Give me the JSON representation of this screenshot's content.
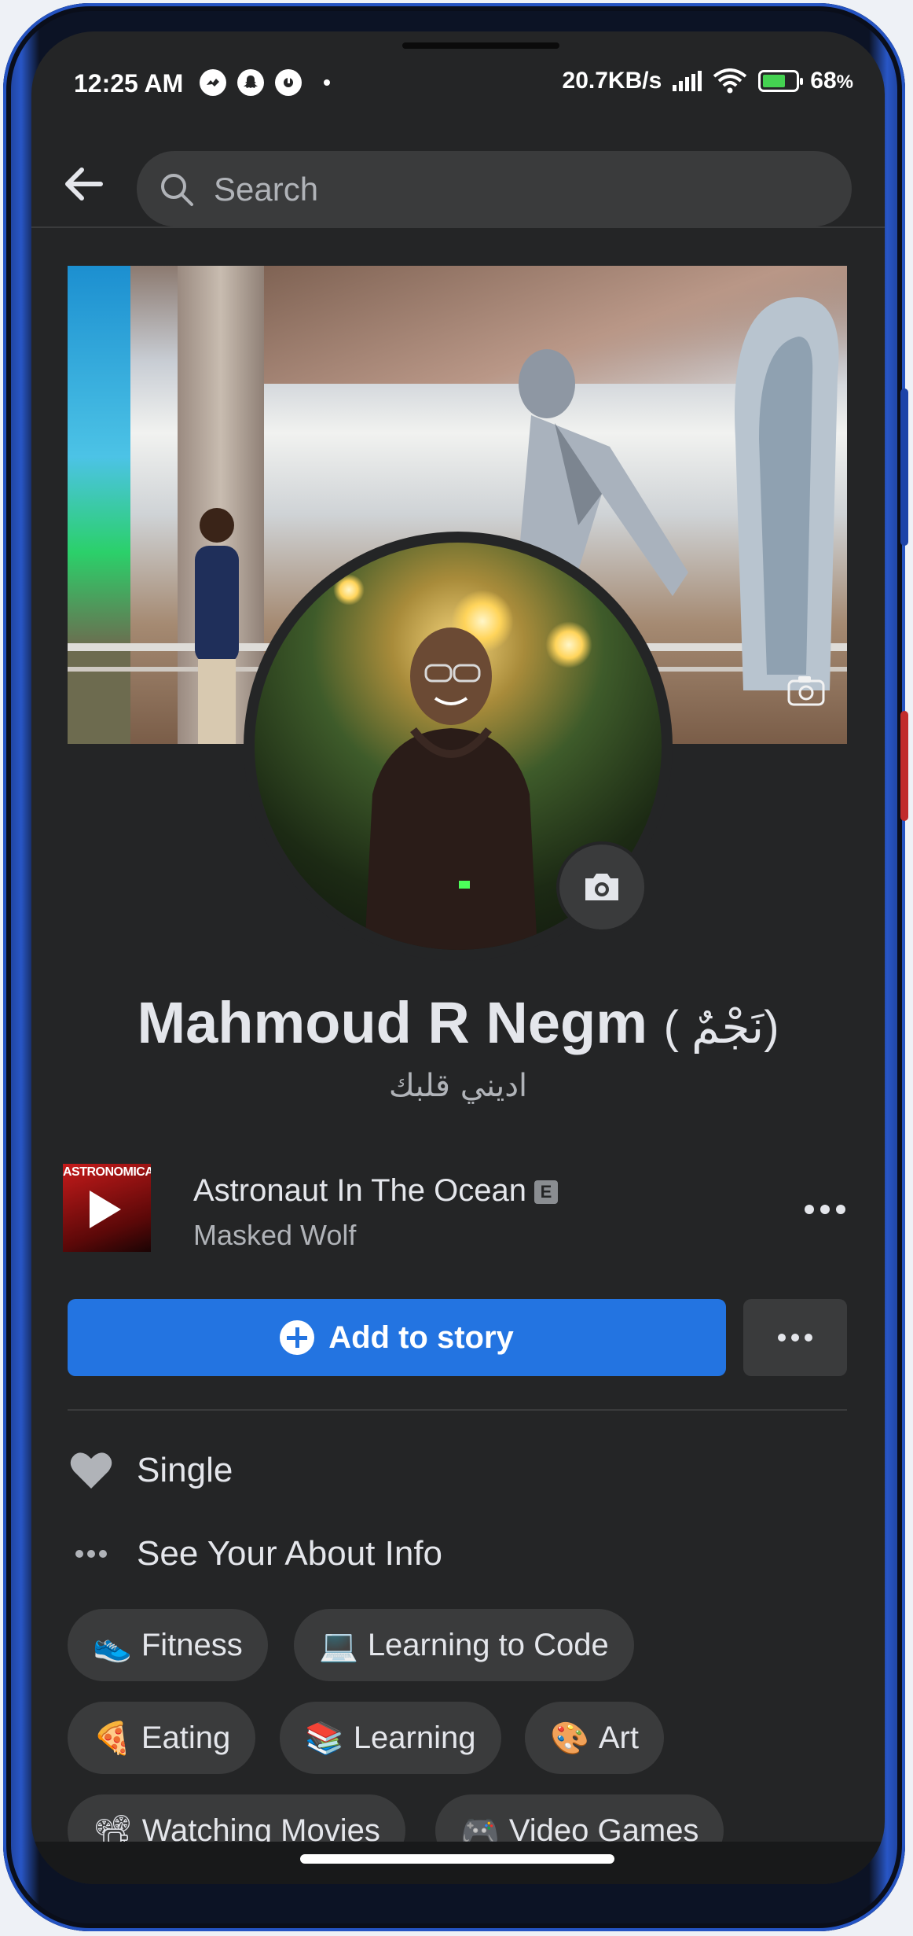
{
  "status_bar": {
    "time": "12:25 AM",
    "network_speed": "20.7KB/s",
    "battery": "68",
    "battery_unit": "%"
  },
  "search": {
    "placeholder": "Search"
  },
  "profile": {
    "name": "Mahmoud R Negm",
    "alt_name": "( نَجْمٌ)",
    "bio": "اديني قلبك"
  },
  "song": {
    "album_text": "ASTRONOMICAL",
    "title": "Astronaut In The Ocean",
    "explicit_badge": "E",
    "artist": "Masked Wolf"
  },
  "actions": {
    "add_story": "Add to story"
  },
  "about": {
    "relationship": "Single",
    "see_about": "See Your About Info"
  },
  "hobbies": [
    {
      "emoji": "👟",
      "label": "Fitness"
    },
    {
      "emoji": "💻",
      "label": "Learning to Code"
    },
    {
      "emoji": "🍕",
      "label": "Eating"
    },
    {
      "emoji": "📚",
      "label": "Learning"
    },
    {
      "emoji": "🎨",
      "label": "Art"
    },
    {
      "emoji": "📽",
      "label": "Watching Movies"
    },
    {
      "emoji": "🎮",
      "label": "Video Games"
    }
  ],
  "icons": {
    "back": "arrow-left-icon",
    "search": "search-icon",
    "camera": "camera-icon",
    "heart": "heart-icon",
    "more": "more-dots-icon",
    "play": "play-icon"
  },
  "colors": {
    "background": "#242526",
    "accent": "#2374e1",
    "chip": "#3a3b3c",
    "text_primary": "#e4e6eb",
    "text_secondary": "#b0b3b8"
  }
}
